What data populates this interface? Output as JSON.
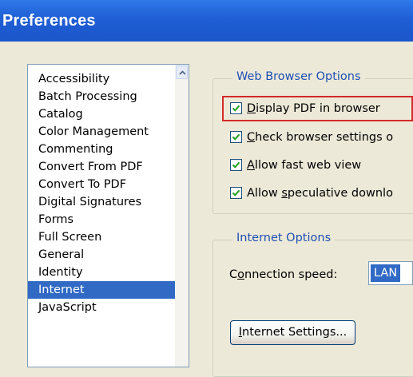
{
  "window": {
    "title": "Preferences"
  },
  "categories": {
    "items": [
      "Accessibility",
      "Batch Processing",
      "Catalog",
      "Color Management",
      "Commenting",
      "Convert From PDF",
      "Convert To PDF",
      "Digital Signatures",
      "Forms",
      "Full Screen",
      "General",
      "Identity",
      "Internet",
      "JavaScript"
    ],
    "selected": "Internet"
  },
  "web_browser_options": {
    "title": "Web Browser Options",
    "options": [
      {
        "label_pre": "",
        "mnemonic": "D",
        "label_post": "isplay PDF in browser",
        "checked": true
      },
      {
        "label_pre": "",
        "mnemonic": "C",
        "label_post": "heck browser settings o",
        "checked": true
      },
      {
        "label_pre": "",
        "mnemonic": "A",
        "label_post": "llow fast web view",
        "checked": true
      },
      {
        "label_pre": "Allow ",
        "mnemonic": "s",
        "label_post": "peculative downlo",
        "checked": true
      }
    ]
  },
  "internet_options": {
    "title": "Internet Options",
    "connection_speed": {
      "label_pre": "C",
      "mnemonic": "o",
      "label_post": "nnection speed:",
      "value": "LAN"
    },
    "settings_button": {
      "mnemonic": "I",
      "label_post": "nternet Settings..."
    }
  },
  "colors": {
    "selection": "#316ac5",
    "highlight_box": "#d42a2a",
    "group_title": "#1f4fb5"
  }
}
